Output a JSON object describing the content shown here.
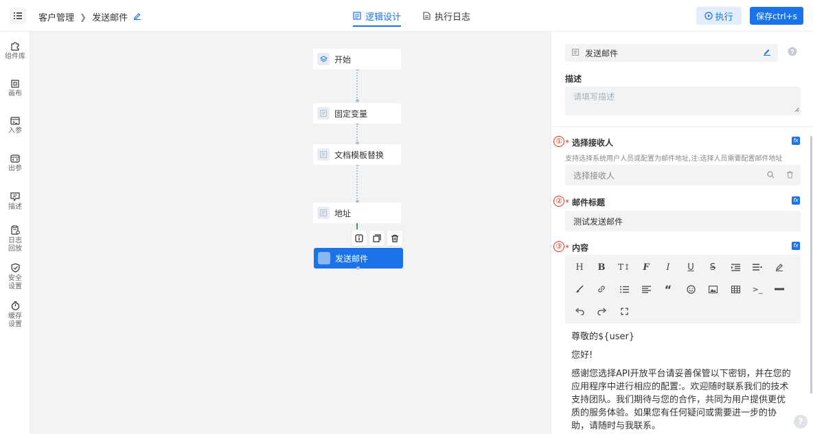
{
  "header": {
    "breadcrumb": [
      "客户管理",
      "发送邮件"
    ],
    "tabs": [
      {
        "label": "逻辑设计",
        "active": true
      },
      {
        "label": "执行日志",
        "active": false
      }
    ],
    "run_label": "执行",
    "save_label": "保存ctrl+s",
    "accent_color": "#1a73e8"
  },
  "sidebar": {
    "items": [
      {
        "label": "组件库",
        "icon": "puzzle-icon"
      },
      {
        "label": "画布",
        "icon": "canvas-icon"
      },
      {
        "label": "入参",
        "icon": "input-param-icon"
      },
      {
        "label": "出参",
        "icon": "output-param-icon"
      },
      {
        "label": "描述",
        "icon": "description-icon"
      },
      {
        "label": "日志回放",
        "icon": "log-replay-icon"
      },
      {
        "label": "安全设置",
        "icon": "shield-icon"
      },
      {
        "label": "缓存设置",
        "icon": "timer-icon"
      }
    ]
  },
  "flow": {
    "nodes": [
      {
        "label": "开始",
        "icon": "layers-icon"
      },
      {
        "label": "固定变量",
        "icon": "form-icon"
      },
      {
        "label": "文档模板替换",
        "icon": "form-icon"
      },
      {
        "label": "地址",
        "icon": "form-icon"
      },
      {
        "label": "发送邮件",
        "icon": "mail-icon",
        "selected": true
      }
    ],
    "node_tools": [
      "info-icon",
      "copy-icon",
      "trash-icon"
    ]
  },
  "panel": {
    "node_name": "发送邮件",
    "description_label": "描述",
    "description_placeholder": "请填写描述",
    "recipients": {
      "index": "①",
      "label": "选择接收人",
      "hint": "支持选择系统用户人员或配置为邮件地址,注:选择人员需要配置邮件地址",
      "placeholder": "选择接收人"
    },
    "subject": {
      "index": "②",
      "label": "邮件标题",
      "value": "测试发送邮件"
    },
    "content": {
      "index": "③",
      "label": "内容",
      "toolbar": [
        "heading",
        "bold",
        "text-size",
        "font",
        "italic",
        "underline",
        "strikethrough",
        "indent",
        "line-height",
        "highlighter",
        "brush",
        "link",
        "bullet-list",
        "align",
        "quote",
        "emoji",
        "image",
        "table",
        "code",
        "horizontal-rule",
        "undo",
        "redo",
        "fullscreen"
      ],
      "paragraphs": [
        "尊敬的${user}",
        "您好!",
        "感谢您选择API开放平台请妥善保管以下密钥，并在您的应用程序中进行相应的配置:。欢迎随时联系我们的技术支持团队。我们期待与您的合作，共同为用户提供更优质的服务体验。如果您有任何疑问或需要进一步的协助，请随时与我联系。"
      ]
    },
    "fx_label": "fx",
    "required_mark": "*"
  }
}
